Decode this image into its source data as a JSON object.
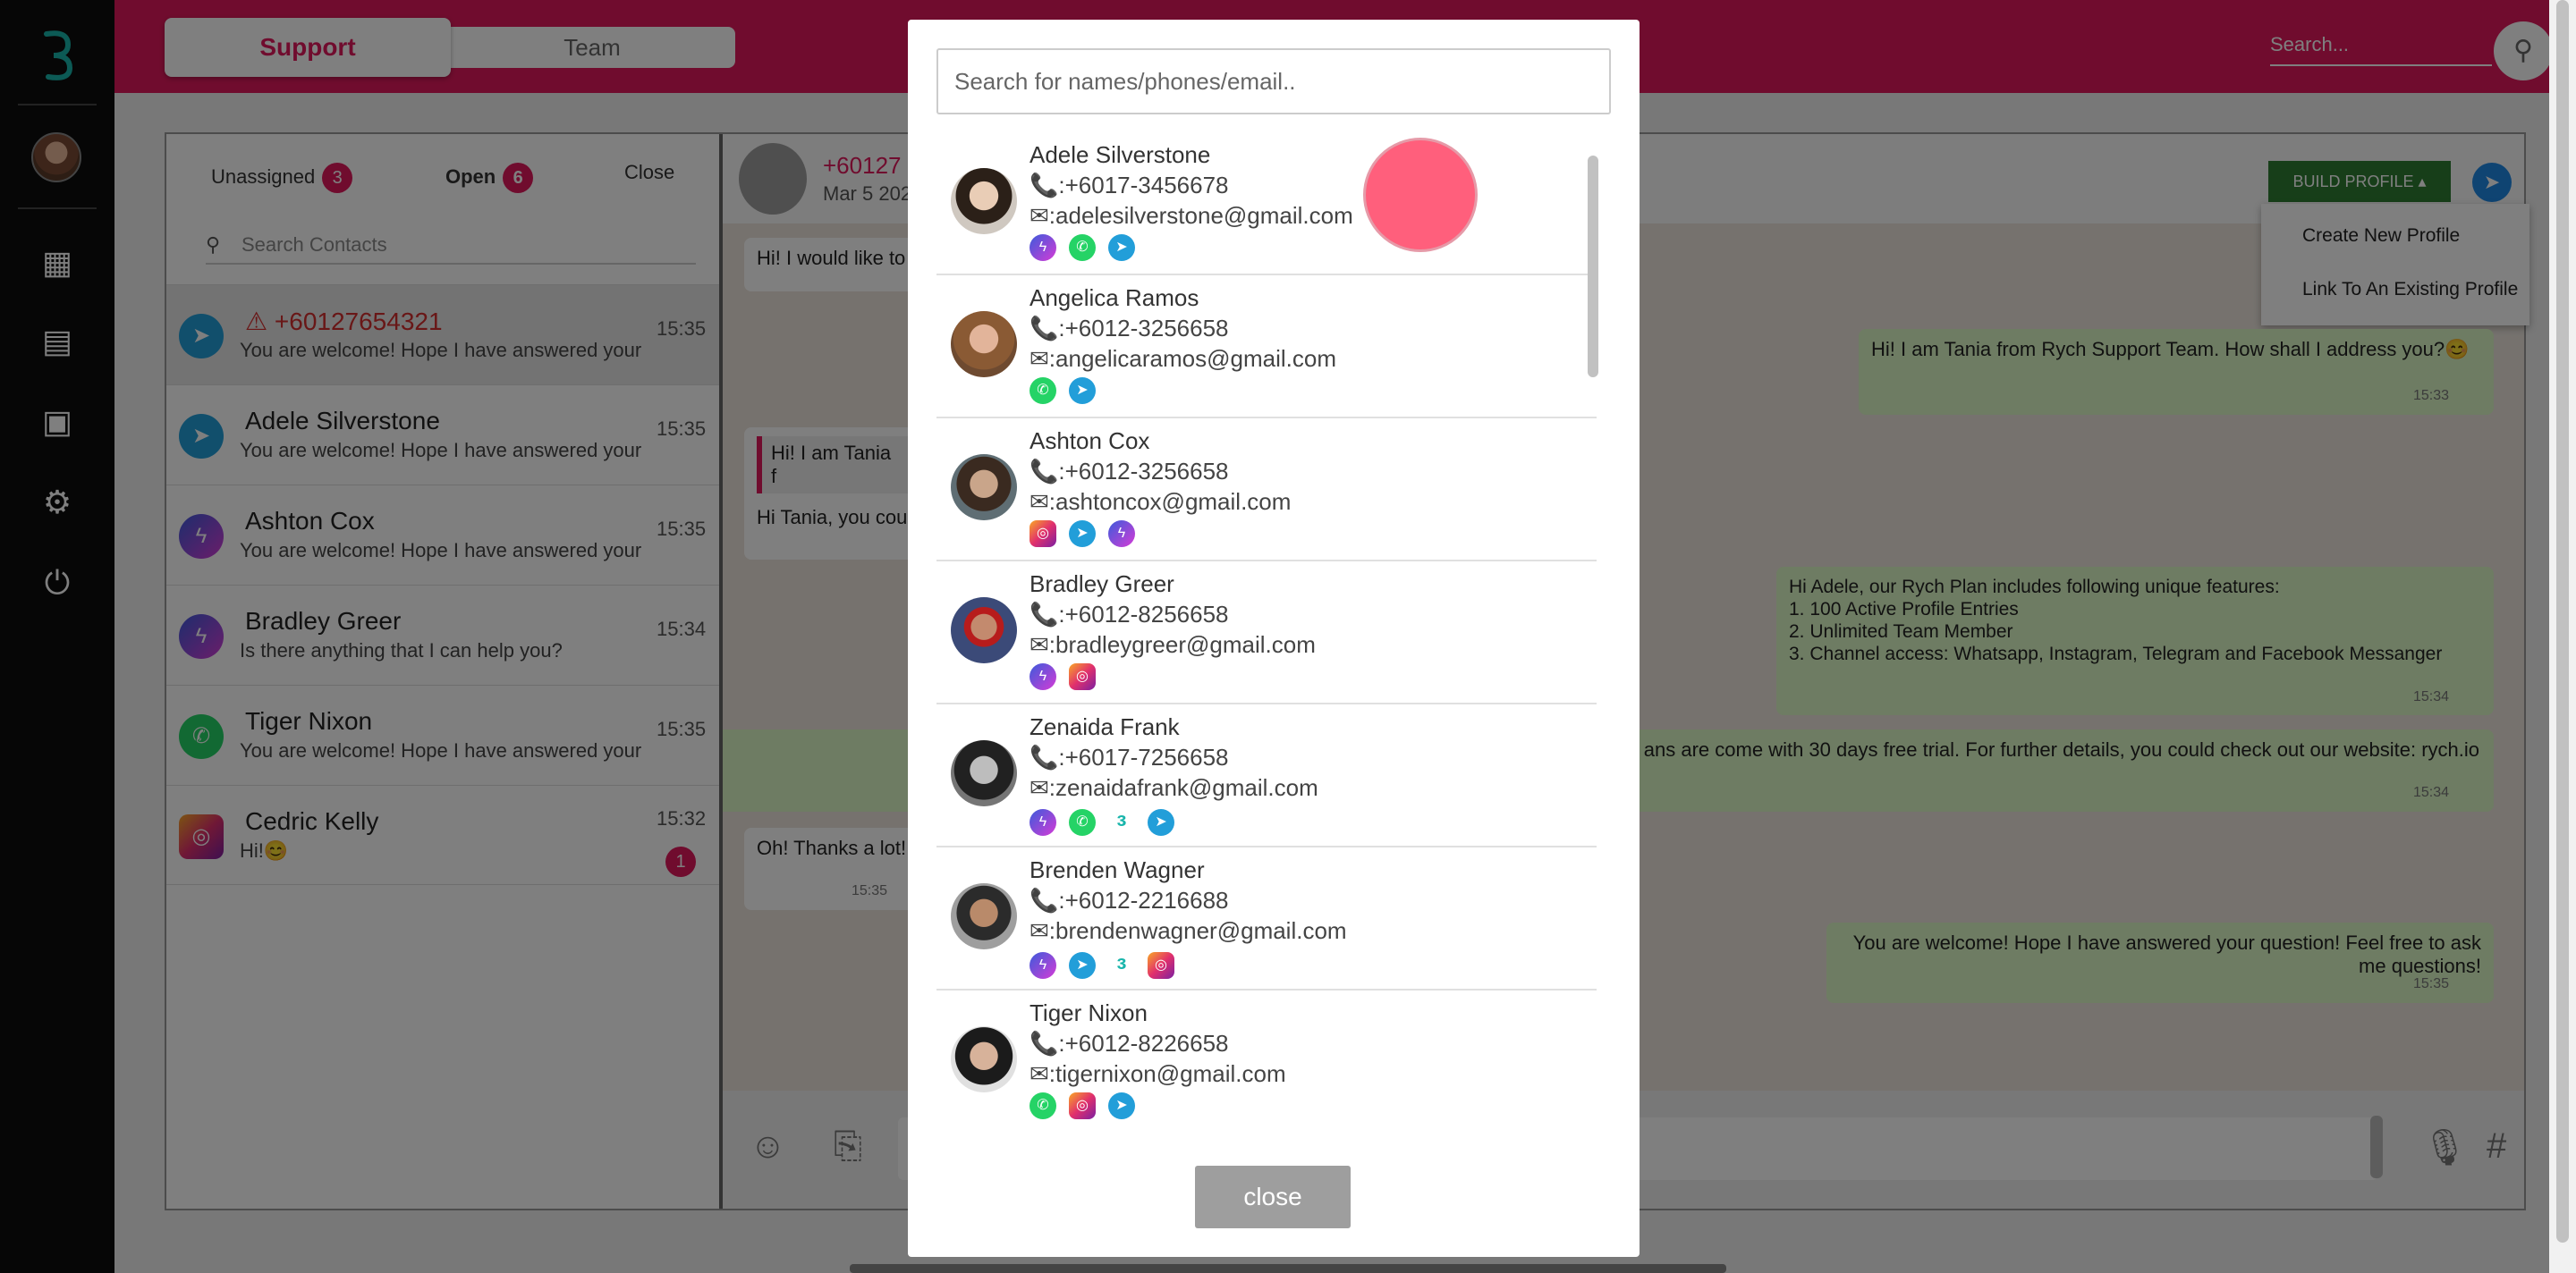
{
  "topbar": {
    "tabs": [
      "Support",
      "Team"
    ],
    "search_placeholder": "Search..."
  },
  "chatlist": {
    "filters": [
      {
        "label": "Unassigned",
        "count": "3"
      },
      {
        "label": "Open",
        "count": "6"
      },
      {
        "label": "Close"
      }
    ],
    "search_placeholder": "Search Contacts",
    "items": [
      {
        "name": "+60127654321",
        "message": "You are welcome! Hope I have answered your question! Feel free to ask me questions!",
        "time": "15:35",
        "channel": "telegram",
        "alert": true
      },
      {
        "name": "Adele Silverstone",
        "message": "You are welcome! Hope I have answered your question! Feel free to ask me questions!",
        "time": "15:35",
        "channel": "telegram"
      },
      {
        "name": "Ashton Cox",
        "message": "You are welcome! Hope I have answered your question! Feel free to ask me questions!",
        "time": "15:35",
        "channel": "messenger"
      },
      {
        "name": "Bradley Greer",
        "message": "Is there anything that I can help you?",
        "time": "15:34",
        "channel": "messenger"
      },
      {
        "name": "Tiger Nixon",
        "message": "You are welcome! Hope I have answered your question! Feel free to ask me questions!",
        "time": "15:35",
        "channel": "whatsapp"
      },
      {
        "name": "Cedric Kelly",
        "message": "Hi!😊",
        "time": "15:32",
        "channel": "instagram",
        "unread": "1"
      }
    ]
  },
  "conversation": {
    "header_number": "+60127",
    "header_date": "Mar 5 202",
    "build_profile": "BUILD PROFILE ▴",
    "dropdown": [
      "Create New Profile",
      "Link To An Existing Profile"
    ],
    "messages": [
      {
        "text": "Hi! I would like to",
        "dir": "in"
      },
      {
        "text": "Hi! I am Tania from Rych Support Team. How shall I address you?😊",
        "time": "15:33",
        "dir": "out"
      },
      {
        "text": "Hi! I am Tania f",
        "dir": "in"
      },
      {
        "text": "Hi Tania, you cou",
        "dir": "in"
      },
      {
        "text": "Hi Adele, our Rych Plan includes following unique features:\n1. 100 Active Profile Entries\n2. Unlimited Team Member\n3. Channel access: Whatsapp, Instagram, Telegram and Facebook Messanger",
        "time": "15:34",
        "dir": "out"
      },
      {
        "text": "ans are come with 30 days free trial. For further details, you could check out our website: rych.io",
        "time": "15:34",
        "dir": "out"
      },
      {
        "text": "Oh! Thanks a lot!",
        "time": "15:35",
        "dir": "in"
      },
      {
        "text": "You are welcome! Hope I have answered your question! Feel free to ask me questions!",
        "time": "15:35",
        "dir": "out"
      }
    ]
  },
  "modal": {
    "search_placeholder": "Search for names/phones/email..",
    "close_label": "close",
    "contacts": [
      {
        "name": "Adele Silverstone",
        "phone": ":+6017-3456678",
        "email": ":adelesilverstone@gmail.com",
        "channels": [
          "messenger",
          "whatsapp",
          "telegram"
        ]
      },
      {
        "name": "Angelica Ramos",
        "phone": ":+6012-3256658",
        "email": ":angelicaramos@gmail.com",
        "channels": [
          "whatsapp",
          "telegram"
        ]
      },
      {
        "name": "Ashton Cox",
        "phone": ":+6012-3256658",
        "email": ":ashtoncox@gmail.com",
        "channels": [
          "instagram",
          "telegram",
          "messenger"
        ]
      },
      {
        "name": "Bradley Greer",
        "phone": ":+6012-8256658",
        "email": ":bradleygreer@gmail.com",
        "channels": [
          "messenger",
          "instagram"
        ]
      },
      {
        "name": "Zenaida Frank",
        "phone": ":+6017-7256658",
        "email": ":zenaidafrank@gmail.com",
        "channels": [
          "messenger",
          "whatsapp",
          "rych",
          "telegram"
        ]
      },
      {
        "name": "Brenden Wagner",
        "phone": ":+6012-2216688",
        "email": ":brendenwagner@gmail.com",
        "channels": [
          "messenger",
          "telegram",
          "rych",
          "instagram"
        ]
      },
      {
        "name": "Tiger Nixon",
        "phone": ":+6012-8226658",
        "email": ":tigernixon@gmail.com",
        "channels": [
          "whatsapp",
          "instagram",
          "telegram"
        ]
      }
    ]
  },
  "colors": {
    "brand": "#e0195c",
    "bubble_out": "#dcf8c6",
    "build": "#2e7d32"
  }
}
